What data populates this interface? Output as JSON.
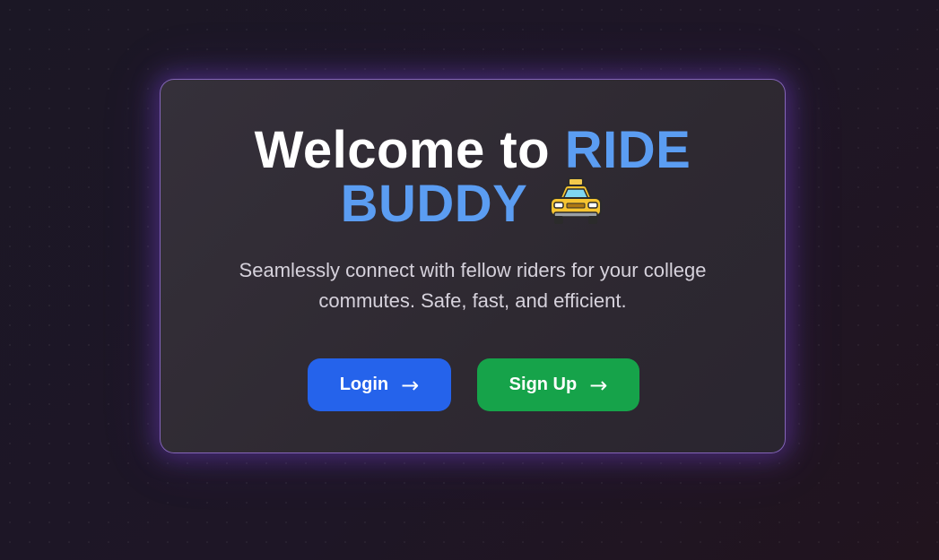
{
  "hero": {
    "title_part1": "Welcome to ",
    "title_accent_1": "RIDE",
    "title_accent_2": "BUDDY",
    "icon": "taxi-icon",
    "subtitle_line1": "Seamlessly connect with fellow riders for your college",
    "subtitle_line2": "commutes. Safe, fast, and efficient."
  },
  "buttons": {
    "login_label": "Login",
    "signup_label": "Sign Up",
    "arrow": "→"
  },
  "colors": {
    "accent_blue": "#5b9df2",
    "login_bg": "#2563eb",
    "signup_bg": "#16a34a",
    "card_border": "#a078e6"
  }
}
